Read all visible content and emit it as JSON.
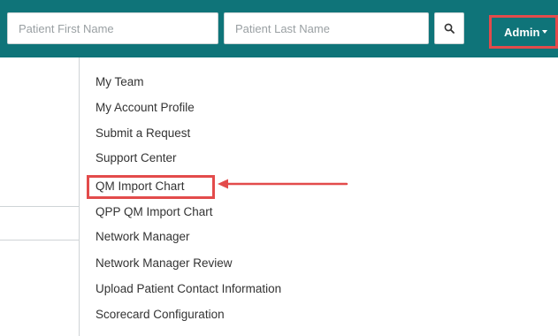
{
  "header": {
    "first_name_placeholder": "Patient First Name",
    "last_name_placeholder": "Patient Last Name",
    "search_icon": "search-icon",
    "admin_label": "Admin"
  },
  "menu": {
    "items": [
      "My Team",
      "My Account Profile",
      "Submit a Request",
      "Support Center",
      "QM Import Chart",
      "QPP QM Import Chart",
      "Network Manager",
      "Network Manager Review",
      "Upload Patient Contact Information",
      "Scorecard Configuration"
    ]
  },
  "colors": {
    "topbar": "#0f7479",
    "highlight": "#e34b4b",
    "text": "#333333"
  }
}
